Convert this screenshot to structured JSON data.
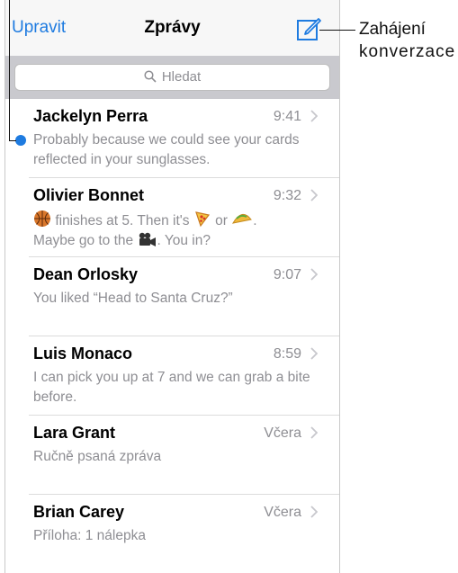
{
  "nav": {
    "edit": "Upravit",
    "title": "Zprávy"
  },
  "search": {
    "placeholder": "Hledat"
  },
  "messages": [
    {
      "name": "Jackelyn Perra",
      "time": "9:41",
      "unread": true,
      "preview": "Probably because we could see your cards reflected in your sunglasses."
    },
    {
      "name": "Olivier Bonnet",
      "time": "9:32",
      "unread": false,
      "p1": "finishes at 5. Then it's",
      "p2": "or",
      "p3": ".",
      "p4": "Maybe go to the",
      "p5": ". You in?",
      "emoji": [
        "basketball-emoji",
        "pizza-emoji",
        "taco-emoji",
        "movie-camera-emoji"
      ]
    },
    {
      "name": "Dean Orlosky",
      "time": "9:07",
      "unread": false,
      "preview": "You liked “Head to Santa Cruz?”"
    },
    {
      "name": "Luis Monaco",
      "time": "8:59",
      "unread": false,
      "preview": "I can pick you up at 7 and we can grab a bite before."
    },
    {
      "name": "Lara Grant",
      "time": "Včera",
      "unread": false,
      "preview": "Ručně psaná zpráva"
    },
    {
      "name": "Brian Carey",
      "time": "Včera",
      "unread": false,
      "preview": "Příloha: 1 nálepka"
    }
  ],
  "callout": {
    "line1": "Zahájení",
    "line2": "konverzace"
  },
  "colors": {
    "accent": "#1e7be0",
    "secondary_text": "#8e8e93",
    "nav_bg": "#f7f7f7",
    "search_bg": "#c9c9ce"
  }
}
